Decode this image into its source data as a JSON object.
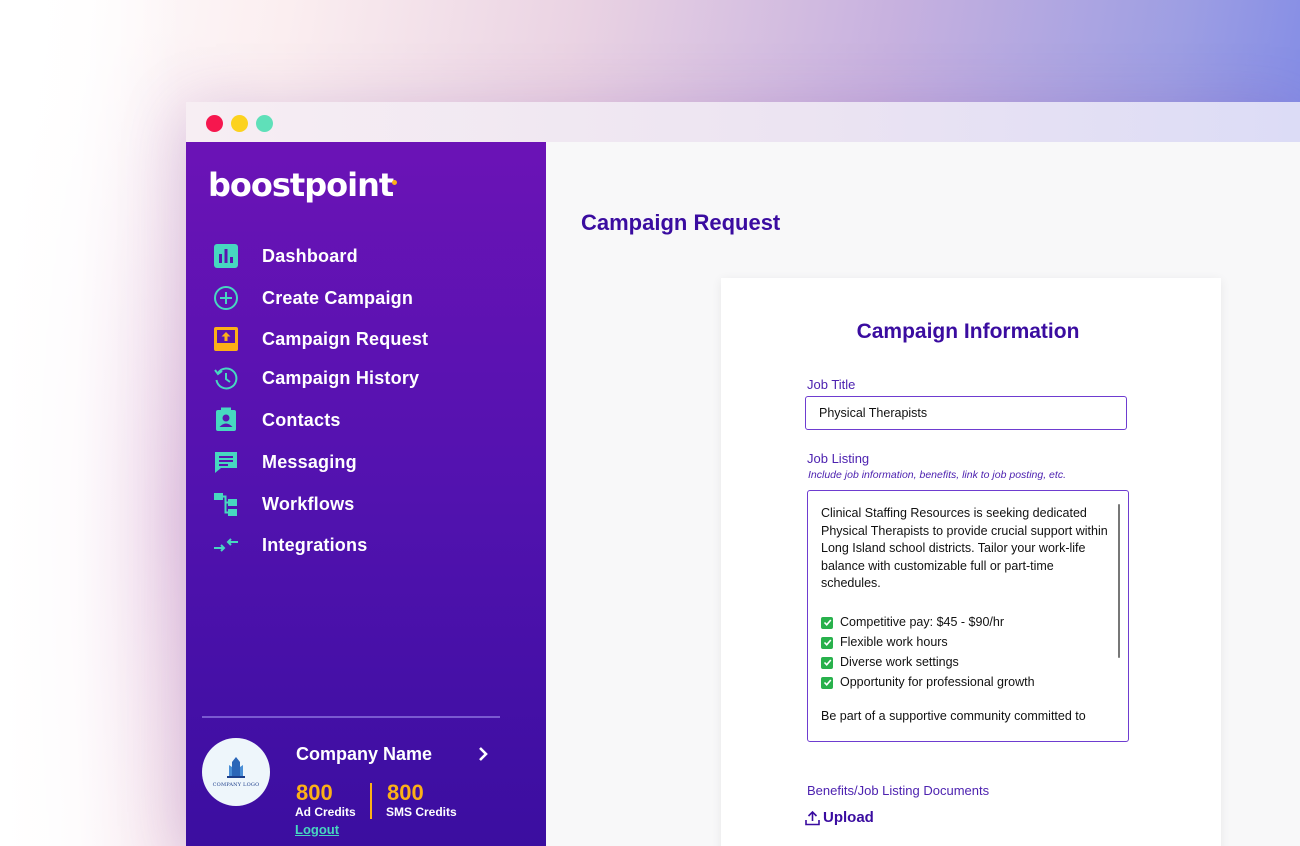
{
  "colors": {
    "sidebar_top": "#6b13b6",
    "sidebar_bottom": "#3b0ea0",
    "accent_teal": "#47d7c0",
    "accent_orange": "#fcb017",
    "title_purple": "#3a0ca0"
  },
  "window": {
    "controls": [
      "close",
      "minimize",
      "maximize"
    ]
  },
  "sidebar": {
    "logo": "boostpoint",
    "items": [
      {
        "label": "Dashboard",
        "icon": "bar-chart-icon"
      },
      {
        "label": "Create Campaign",
        "icon": "plus-circle-icon"
      },
      {
        "label": "Campaign Request",
        "icon": "upload-tray-icon"
      },
      {
        "label": "Campaign History",
        "icon": "history-icon"
      },
      {
        "label": "Contacts",
        "icon": "contact-card-icon"
      },
      {
        "label": "Messaging",
        "icon": "chat-icon"
      },
      {
        "label": "Workflows",
        "icon": "workflow-icon"
      },
      {
        "label": "Integrations",
        "icon": "arrows-icon"
      }
    ],
    "account": {
      "avatar_text": "COMPANY LOGO",
      "company_name": "Company Name",
      "ad_credits": "800",
      "ad_credits_label": "Ad Credits",
      "sms_credits": "800",
      "sms_credits_label": "SMS Credits",
      "logout": "Logout"
    }
  },
  "main": {
    "page_title": "Campaign Request",
    "card": {
      "title": "Campaign Information",
      "job_title_label": "Job Title",
      "job_title_value": "Physical Therapists",
      "job_listing_label": "Job Listing",
      "job_listing_hint": "Include job information, benefits, link to job posting, etc.",
      "job_listing_intro": "Clinical Staffing Resources is seeking dedicated Physical Therapists to provide crucial support within Long Island school districts. Tailor your work-life balance with customizable full or part-time schedules.",
      "job_listing_bullets": [
        "Competitive pay: $45 - $90/hr",
        "Flexible work hours",
        "Diverse work settings",
        "Opportunity for professional growth"
      ],
      "job_listing_outro": "Be part of a supportive community committed to",
      "documents_label": "Benefits/Job Listing Documents",
      "upload_label": "Upload"
    }
  }
}
